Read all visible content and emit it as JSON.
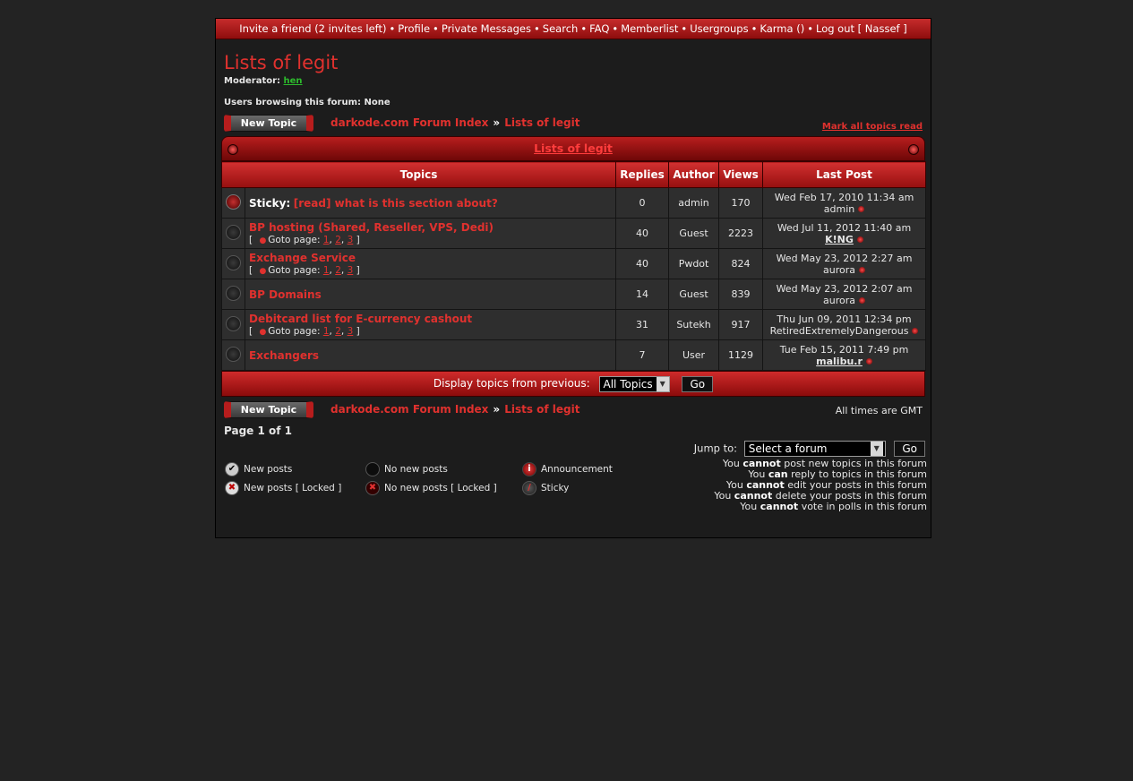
{
  "navbar": {
    "items": [
      "Invite a friend (2 invites left)",
      "Profile",
      "Private Messages",
      "Search",
      "FAQ",
      "Memberlist",
      "Usergroups",
      "Karma ()",
      "Log out [ Nassef ]"
    ]
  },
  "forum": {
    "title": "Lists of legit",
    "moderator_label": "Moderator:",
    "moderator_name": "hen",
    "browsing": "Users browsing this forum: None",
    "new_topic_label": "New Topic",
    "mark_all": "Mark all topics read"
  },
  "breadcrumb": {
    "index": "darkode.com Forum Index",
    "sep": "»",
    "current": "Lists of legit"
  },
  "table": {
    "caption": "Lists of legit",
    "headers": [
      "Topics",
      "Replies",
      "Author",
      "Views",
      "Last Post"
    ],
    "goto_label": "Goto page:",
    "rows": [
      {
        "prefix": "Sticky:",
        "title": "[read] what is this section about?",
        "replies": "0",
        "author": "admin",
        "views": "170",
        "last_date": "Wed Feb 17, 2010 11:34 am",
        "last_user": "admin",
        "pages": []
      },
      {
        "prefix": "",
        "title": "BP hosting (Shared, Reseller, VPS, Dedi)",
        "replies": "40",
        "author": "Guest",
        "views": "2223",
        "last_date": "Wed Jul 11, 2012 11:40 am",
        "last_user": "K!NG",
        "pages": [
          "1",
          "2",
          "3"
        ]
      },
      {
        "prefix": "",
        "title": "Exchange Service",
        "replies": "40",
        "author": "Pwdot",
        "views": "824",
        "last_date": "Wed May 23, 2012 2:27 am",
        "last_user": "aurora",
        "pages": [
          "1",
          "2",
          "3"
        ]
      },
      {
        "prefix": "",
        "title": "BP Domains",
        "replies": "14",
        "author": "Guest",
        "views": "839",
        "last_date": "Wed May 23, 2012 2:07 am",
        "last_user": "aurora",
        "pages": []
      },
      {
        "prefix": "",
        "title": "Debitcard list for E-currency cashout",
        "replies": "31",
        "author": "Sutekh",
        "views": "917",
        "last_date": "Thu Jun 09, 2011 12:34 pm",
        "last_user": "RetiredExtremelyDangerous",
        "pages": [
          "1",
          "2",
          "3"
        ]
      },
      {
        "prefix": "",
        "title": "Exchangers",
        "replies": "7",
        "author": "User",
        "views": "1129",
        "last_date": "Tue Feb 15, 2011 7:49 pm",
        "last_user": "malibu.r",
        "pages": []
      }
    ]
  },
  "filter": {
    "label": "Display topics from previous:",
    "selected": "All Topics",
    "go": "Go"
  },
  "footer": {
    "times": "All times are GMT",
    "page": "Page 1 of 1",
    "jump_label": "Jump to:",
    "jump_selected": "Select a forum",
    "jump_go": "Go"
  },
  "legend": {
    "new_posts": "New posts",
    "new_posts_locked": "New posts [ Locked ]",
    "no_new_posts": "No new posts",
    "no_new_posts_locked": "No new posts [ Locked ]",
    "announcement": "Announcement",
    "sticky": "Sticky"
  },
  "permissions": [
    {
      "pre": "You",
      "word": "cannot",
      "post": "post new topics in this forum"
    },
    {
      "pre": "You",
      "word": "can",
      "post": "reply to topics in this forum"
    },
    {
      "pre": "You",
      "word": "cannot",
      "post": "edit your posts in this forum"
    },
    {
      "pre": "You",
      "word": "cannot",
      "post": "delete your posts in this forum"
    },
    {
      "pre": "You",
      "word": "cannot",
      "post": "vote in polls in this forum"
    }
  ],
  "colors": {
    "accent": "#e0312e",
    "header_red": "#b81e1e",
    "background": "#232323",
    "panel": "#1c1c1c"
  }
}
